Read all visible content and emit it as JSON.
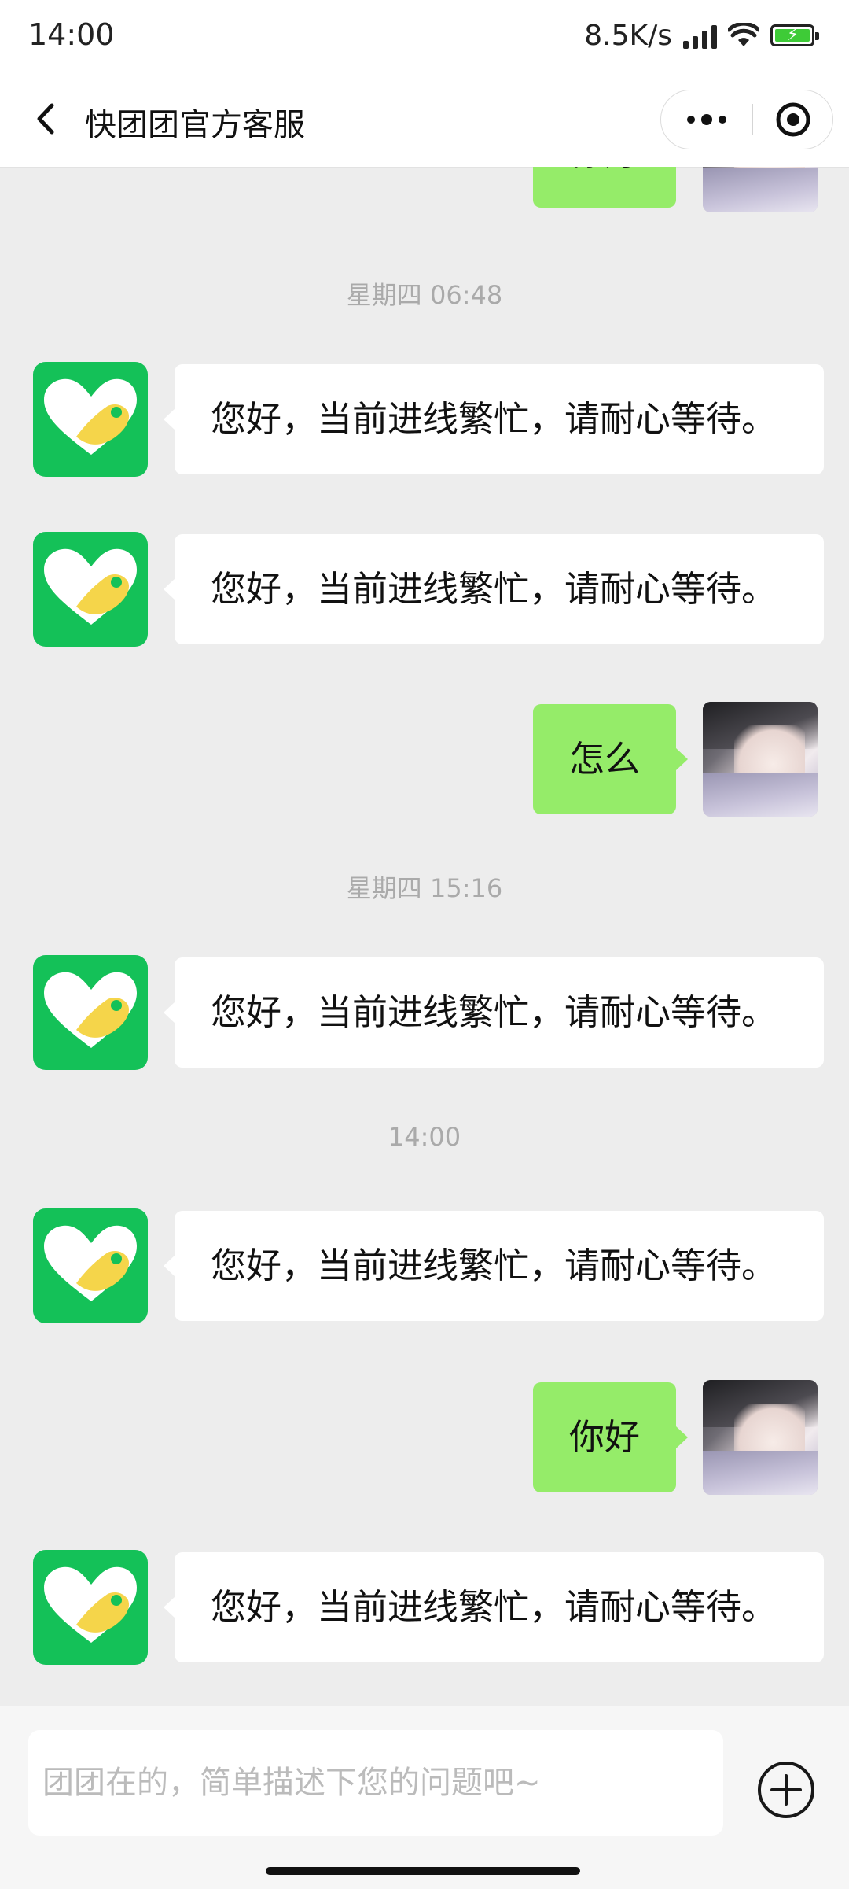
{
  "status_bar": {
    "time": "14:00",
    "network_speed": "8.5K/s",
    "icons": [
      "signal-icon",
      "wifi-icon",
      "battery-charging-icon"
    ]
  },
  "nav": {
    "title": "快团团官方客服",
    "back_icon": "chevron-left-icon",
    "more_icon": "more-dots-icon",
    "close_icon": "target-circle-icon"
  },
  "messages": [
    {
      "type": "outgoing",
      "text": "你好",
      "partially_visible": true
    },
    {
      "type": "timestamp",
      "text": "星期四 06:48"
    },
    {
      "type": "incoming",
      "text": "您好，当前进线繁忙，请耐心等待。"
    },
    {
      "type": "incoming",
      "text": "您好，当前进线繁忙，请耐心等待。"
    },
    {
      "type": "outgoing",
      "text": "怎么"
    },
    {
      "type": "timestamp",
      "text": "星期四 15:16"
    },
    {
      "type": "incoming",
      "text": "您好，当前进线繁忙，请耐心等待。"
    },
    {
      "type": "timestamp",
      "text": "14:00"
    },
    {
      "type": "incoming",
      "text": "您好，当前进线繁忙，请耐心等待。"
    },
    {
      "type": "outgoing",
      "text": "你好"
    },
    {
      "type": "incoming",
      "text": "您好，当前进线繁忙，请耐心等待。"
    }
  ],
  "input": {
    "placeholder": "团团在的，简单描述下您的问题吧~",
    "value": "",
    "plus_icon": "plus-circle-icon"
  },
  "colors": {
    "bot_avatar_bg": "#14c158",
    "bot_avatar_heart": "#ffffff",
    "bot_avatar_accent": "#f5d54a",
    "outgoing_bubble": "#95ec69",
    "incoming_bubble": "#ffffff",
    "chat_bg": "#ededed"
  }
}
